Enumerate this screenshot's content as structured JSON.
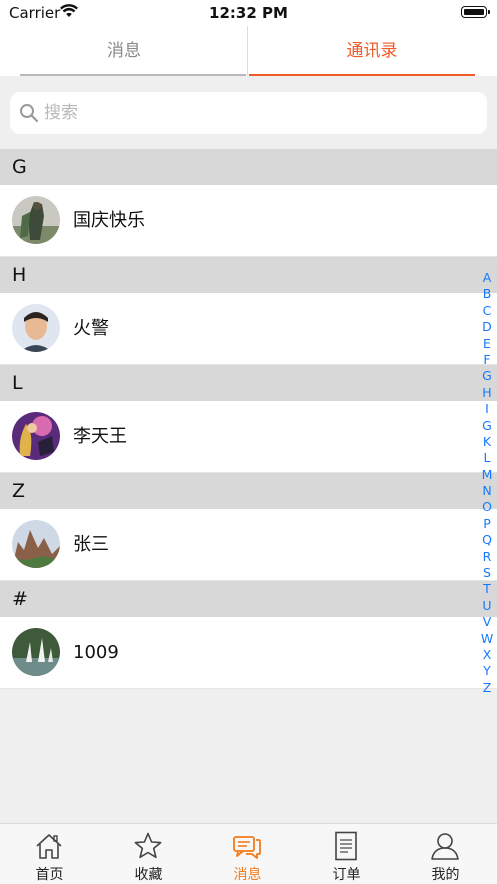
{
  "status_bar": {
    "carrier": "Carrier",
    "time": "12:32 PM"
  },
  "tabs": [
    {
      "label": "消息",
      "active": false
    },
    {
      "label": "通讯录",
      "active": true
    }
  ],
  "search": {
    "placeholder": "搜索"
  },
  "sections": [
    {
      "letter": "G",
      "contacts": [
        {
          "name": "国庆快乐",
          "avatar": "game-character-avatar"
        }
      ]
    },
    {
      "letter": "H",
      "contacts": [
        {
          "name": "火警",
          "avatar": "man-photo-avatar"
        }
      ]
    },
    {
      "letter": "L",
      "contacts": [
        {
          "name": "李天王",
          "avatar": "fantasy-art-avatar"
        }
      ]
    },
    {
      "letter": "Z",
      "contacts": [
        {
          "name": "张三",
          "avatar": "landscape-photo-avatar"
        }
      ]
    },
    {
      "letter": "#",
      "contacts": [
        {
          "name": "1009",
          "avatar": "boats-photo-avatar"
        }
      ]
    }
  ],
  "index_letters": [
    "A",
    "B",
    "C",
    "D",
    "E",
    "F",
    "G",
    "H",
    "I",
    "G",
    "K",
    "L",
    "M",
    "N",
    "O",
    "P",
    "Q",
    "R",
    "S",
    "T",
    "U",
    "V",
    "W",
    "X",
    "Y",
    "Z"
  ],
  "bottom_tabs": [
    {
      "label": "首页",
      "icon": "home-icon",
      "active": false
    },
    {
      "label": "收藏",
      "icon": "star-icon",
      "active": false
    },
    {
      "label": "消息",
      "icon": "chat-icon",
      "active": true
    },
    {
      "label": "订单",
      "icon": "document-icon",
      "active": false
    },
    {
      "label": "我的",
      "icon": "person-icon",
      "active": false
    }
  ],
  "colors": {
    "accent": "#ef5b26",
    "tab_active": "#f47b19",
    "index_letters": "#1479ff"
  }
}
